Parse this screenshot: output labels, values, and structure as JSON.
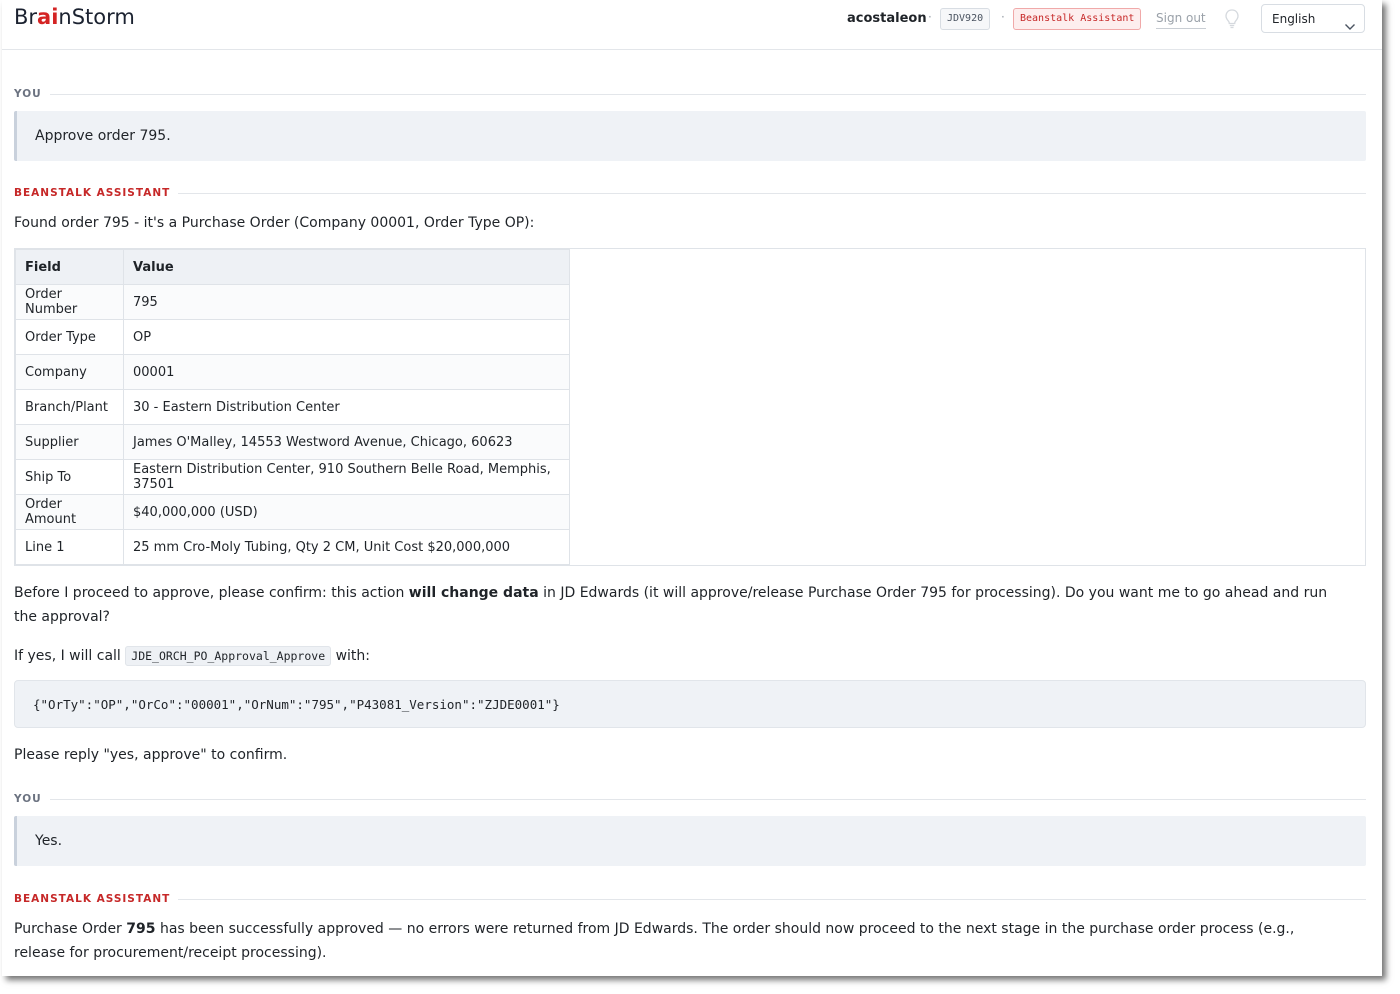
{
  "header": {
    "logo": {
      "part1": "Br",
      "part2": "ai",
      "part3": "nStorm"
    },
    "username": "acostaleon",
    "environment": "JDV920",
    "assistant_badge": "Beanstalk Assistant",
    "sign_out": "Sign out",
    "language": "English"
  },
  "colors": {
    "accent_red": "#c62828",
    "user_bg": "#eff2f6"
  },
  "messages": [
    {
      "role": "YOU",
      "text": "Approve order 795."
    },
    {
      "role": "BEANSTALK ASSISTANT",
      "intro": "Found order 795 - it's a Purchase Order (Company 00001, Order Type OP):",
      "table": {
        "headers": [
          "Field",
          "Value"
        ],
        "rows": [
          [
            "Order Number",
            "795"
          ],
          [
            "Order Type",
            "OP"
          ],
          [
            "Company",
            "00001"
          ],
          [
            "Branch/Plant",
            "30 - Eastern Distribution Center"
          ],
          [
            "Supplier",
            "James O'Malley, 14553 Westword Avenue, Chicago, 60623"
          ],
          [
            "Ship To",
            "Eastern Distribution Center, 910 Southern Belle Road, Memphis, 37501"
          ],
          [
            "Order Amount",
            "$40,000,000 (USD)"
          ],
          [
            "Line 1",
            "25 mm Cro-Moly Tubing, Qty 2 CM, Unit Cost $20,000,000"
          ]
        ]
      },
      "confirm_pre": "Before I proceed to approve, please confirm: this action ",
      "confirm_bold": "will change data",
      "confirm_post": " in JD Edwards (it will approve/release Purchase Order 795 for processing). Do you want me to go ahead and run the approval?",
      "call_pre": "If yes, I will call ",
      "call_code": "JDE_ORCH_PO_Approval_Approve",
      "call_post": " with:",
      "code_block": "{\"OrTy\":\"OP\",\"OrCo\":\"00001\",\"OrNum\":\"795\",\"P43081_Version\":\"ZJDE0001\"}",
      "reply_hint": "Please reply \"yes, approve\" to confirm."
    },
    {
      "role": "YOU",
      "text": "Yes."
    },
    {
      "role": "BEANSTALK ASSISTANT",
      "result_pre": "Purchase Order ",
      "result_bold": "795",
      "result_post": " has been successfully approved — no errors were returned from JD Edwards. The order should now proceed to the next stage in the purchase order process (e.g., release for procurement/receipt processing)."
    }
  ]
}
